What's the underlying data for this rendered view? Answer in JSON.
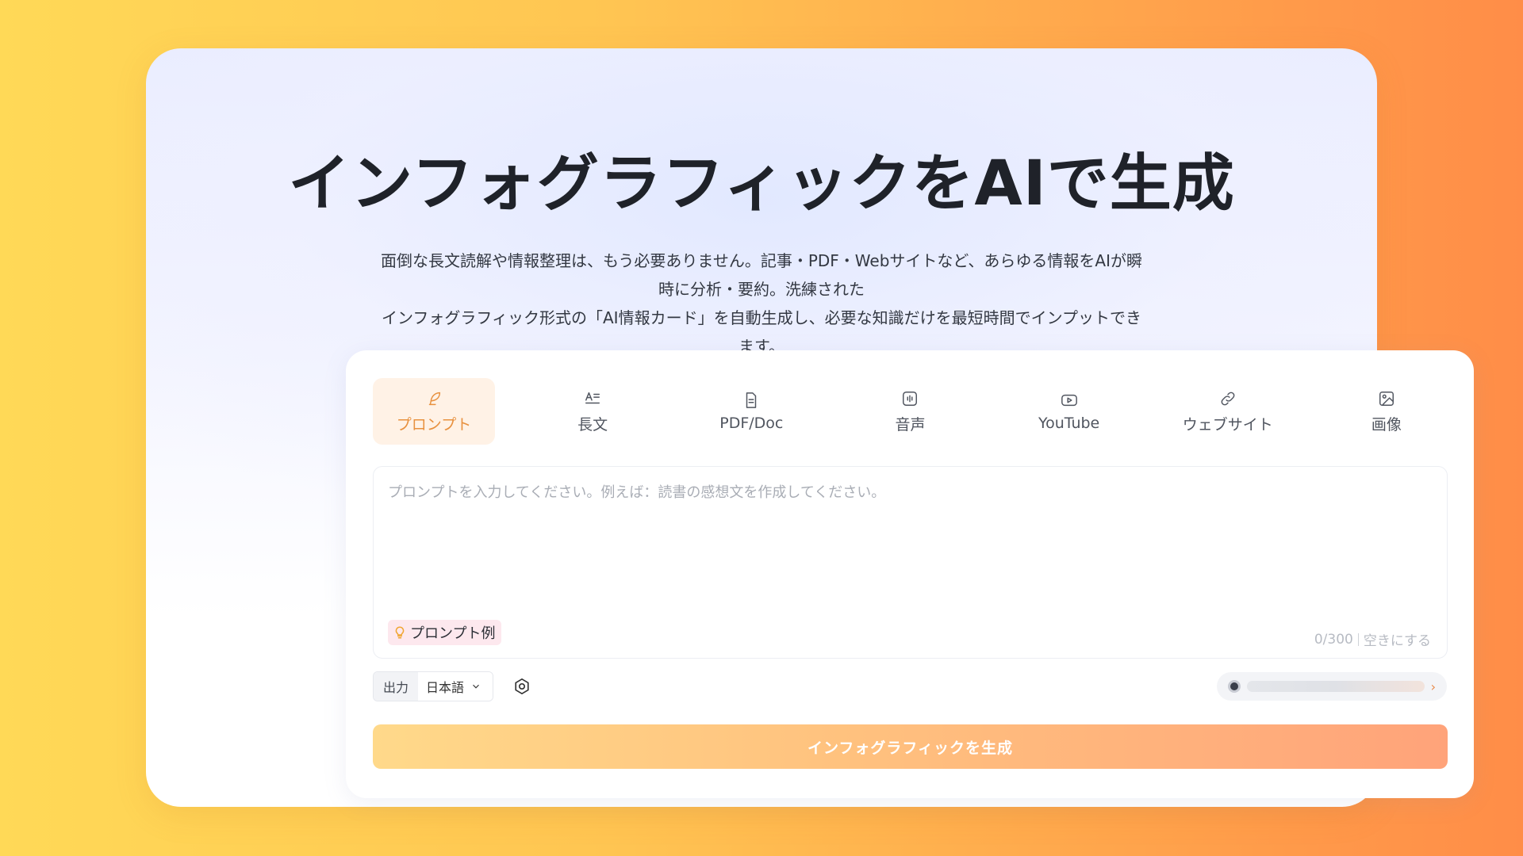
{
  "hero": {
    "title": "インフォグラフィックをAIで生成",
    "description_line1": "面倒な長文読解や情報整理は、もう必要ありません。記事・PDF・Webサイトなど、あらゆる情報をAIが瞬時に分析・要約。洗練された",
    "description_line2": "インフォグラフィック形式の「AI情報カード」を自動生成し、必要な知識だけを最短時間でインプットできます。"
  },
  "tabs": [
    {
      "label": "プロンプト",
      "icon": "feather-icon",
      "active": true
    },
    {
      "label": "長文",
      "icon": "text-lines-icon",
      "active": false
    },
    {
      "label": "PDF/Doc",
      "icon": "document-icon",
      "active": false
    },
    {
      "label": "音声",
      "icon": "audio-icon",
      "active": false
    },
    {
      "label": "YouTube",
      "icon": "play-icon",
      "active": false
    },
    {
      "label": "ウェブサイト",
      "icon": "link-icon",
      "active": false
    },
    {
      "label": "画像",
      "icon": "image-icon",
      "active": false
    }
  ],
  "prompt": {
    "value": "",
    "placeholder": "プロンプトを入力してください。例えば：読書の感想文を作成してください。",
    "example_label": "プロンプト例",
    "char_count": "0/300",
    "clear_label": "空きにする"
  },
  "output": {
    "label": "出力",
    "language": "日本語"
  },
  "model": {
    "chevron": "›"
  },
  "generate_label": "インフォグラフィックを生成",
  "colors": {
    "accent": "#e8913f",
    "active_tab_bg": "#fff2e6",
    "button_start": "#ffd98a",
    "button_end": "#ffa37a"
  }
}
